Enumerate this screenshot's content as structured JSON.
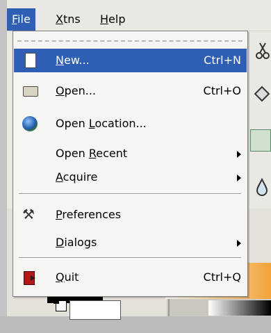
{
  "menubar": {
    "items": [
      {
        "label": "File",
        "mnemonic": "F",
        "rest": "ile",
        "active": true
      },
      {
        "label": "Xtns",
        "mnemonic": "X",
        "rest": "tns",
        "active": false
      },
      {
        "label": "Help",
        "mnemonic": "H",
        "rest": "elp",
        "active": false
      }
    ]
  },
  "file_menu": {
    "items": [
      {
        "label": "New...",
        "u": "N",
        "rest": "ew...",
        "accel": "Ctrl+N",
        "icon": "new-document-icon",
        "highlighted": true
      },
      {
        "label": "Open...",
        "u": "O",
        "rest": "pen...",
        "accel": "Ctrl+O",
        "icon": "open-folder-icon"
      },
      {
        "label": "Open Location...",
        "pre": "Open ",
        "u": "L",
        "rest": "ocation...",
        "accel": "",
        "icon": "globe-icon"
      },
      {
        "label": "Open Recent",
        "pre": "Open ",
        "u": "R",
        "rest": "ecent",
        "submenu": true
      },
      {
        "label": "Acquire",
        "u": "A",
        "rest": "cquire",
        "submenu": true
      },
      {
        "label": "Preferences",
        "u": "P",
        "rest": "references",
        "icon": "preferences-tools-icon"
      },
      {
        "label": "Dialogs",
        "u": "D",
        "rest": "ialogs",
        "submenu": true
      },
      {
        "label": "Quit",
        "u": "Q",
        "rest": "uit",
        "accel": "Ctrl+Q",
        "icon": "quit-icon"
      }
    ]
  },
  "colors": {
    "highlight": "#2f5fb5",
    "menu_bg": "#f5f5f3",
    "window_bg": "#e9e8e2"
  }
}
